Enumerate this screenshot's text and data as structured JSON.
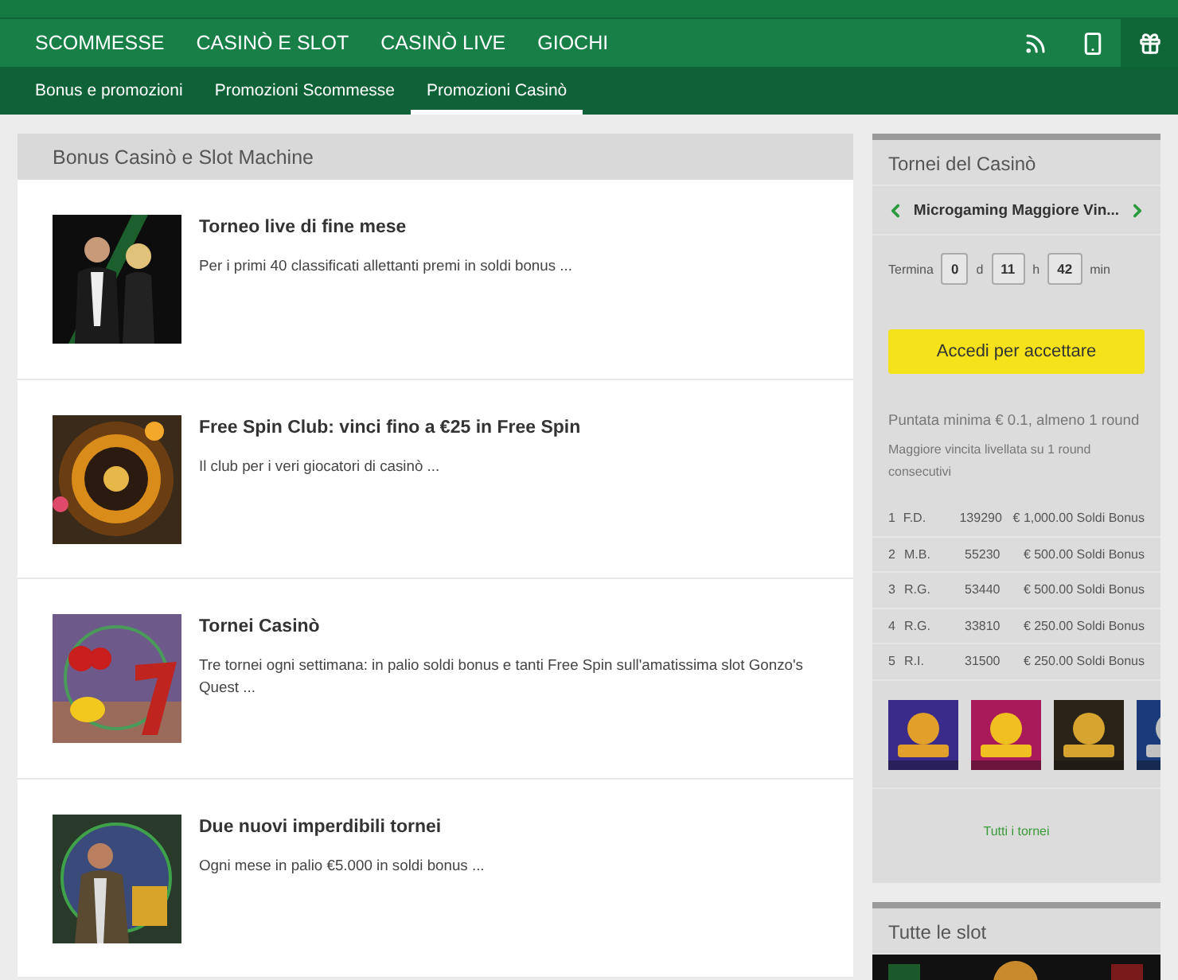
{
  "nav": {
    "items": [
      {
        "label": "SCOMMESSE"
      },
      {
        "label": "CASINÒ E SLOT"
      },
      {
        "label": "CASINÒ LIVE"
      },
      {
        "label": "GIOCHI"
      }
    ],
    "icon_buttons": [
      {
        "selected": false
      },
      {
        "selected": false
      },
      {
        "selected": true
      }
    ]
  },
  "subnav": [
    {
      "label": "Bonus e promozioni",
      "selected": false
    },
    {
      "label": "Promozioni Scommesse",
      "selected": false
    },
    {
      "label": "Promozioni Casinò",
      "selected": true
    }
  ],
  "promotions": {
    "title": "Bonus Casinò e Slot Machine",
    "items": [
      {
        "title": "Torneo live di fine mese",
        "description": "Per i primi 40 classificati allettanti premi in soldi bonus ..."
      },
      {
        "title": "Free Spin Club: vinci fino a €25 in Free Spin",
        "description": "Il club per i veri giocatori di casinò ..."
      },
      {
        "title": "Tornei Casinò",
        "description": "Tre tornei ogni settimana: in palio soldi bonus e tanti Free Spin sull'amatissima slot Gonzo's Quest ..."
      },
      {
        "title": "Due nuovi imperdibili tornei",
        "description": "Ogni mese in palio €5.000 in soldi bonus ..."
      }
    ]
  },
  "tournaments": {
    "title": "Tornei del Casinò",
    "current": "Microgaming Maggiore Vin...",
    "countdown": {
      "label": "Termina",
      "parts": [
        {
          "value": "0",
          "unit": "d"
        },
        {
          "value": "11",
          "unit": "h"
        },
        {
          "value": "42",
          "unit": "min"
        }
      ]
    },
    "button": "Accedi per accettare",
    "min_bet": "Puntata minima € 0.1, almeno 1 round",
    "rule": "Maggiore vincita livellata su 1 round consecutivi",
    "ranking": [
      {
        "rank": "1",
        "player": "F.D.",
        "points": "139290",
        "prize": "€ 1,000.00 Soldi Bonus"
      },
      {
        "rank": "2",
        "player": "M.B.",
        "points": "55230",
        "prize": "€ 500.00 Soldi Bonus"
      },
      {
        "rank": "3",
        "player": "R.G.",
        "points": "53440",
        "prize": "€ 500.00 Soldi Bonus"
      },
      {
        "rank": "4",
        "player": "R.G.",
        "points": "33810",
        "prize": "€ 250.00 Soldi Bonus"
      },
      {
        "rank": "5",
        "player": "R.I.",
        "points": "31500",
        "prize": "€ 250.00 Soldi Bonus"
      }
    ],
    "link": "Tutti i tornei"
  },
  "slots": {
    "title": "Tutte le slot"
  }
}
